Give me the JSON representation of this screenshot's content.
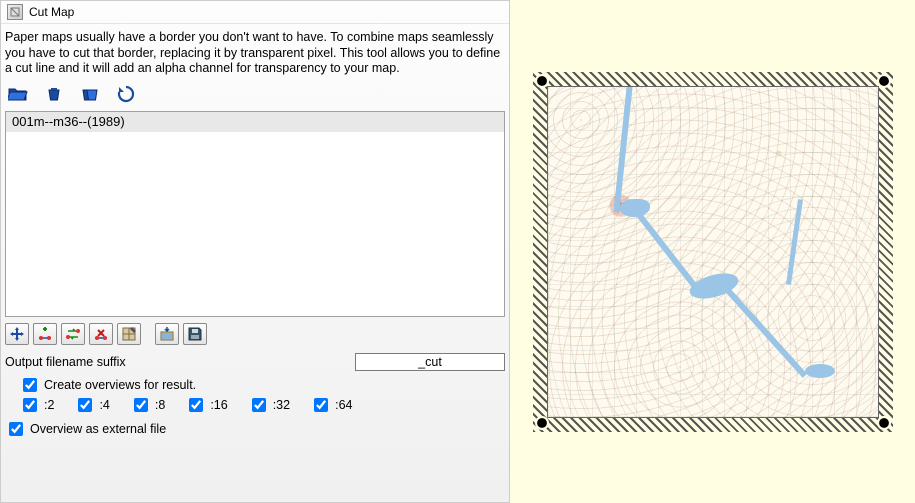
{
  "title": "Cut Map",
  "description": "Paper maps usually have a border you don't want to have. To combine maps seamlessly you have to cut that border, replacing it by transparent pixel. This tool allows you to define a cut line and it will add an alpha channel for transparency to your map.",
  "list": {
    "items": [
      "001m--m36--(1989)"
    ]
  },
  "form": {
    "suffix_label": "Output filename suffix",
    "suffix_value": "_cut",
    "create_overviews_label": "Create overviews for result.",
    "create_overviews_checked": true,
    "levels": [
      {
        "label": ":2",
        "checked": true
      },
      {
        "label": ":4",
        "checked": true
      },
      {
        "label": ":8",
        "checked": true
      },
      {
        "label": ":16",
        "checked": true
      },
      {
        "label": ":32",
        "checked": true
      },
      {
        "label": ":64",
        "checked": true
      }
    ],
    "external_label": "Overview as external file",
    "external_checked": true
  },
  "toolbar1": {
    "open": "Open",
    "delete": "Delete",
    "delete_all": "Delete all",
    "reload": "Reload"
  },
  "toolbar2": {
    "move": "Move",
    "add_point": "Add point",
    "swap": "Swap",
    "remove_point": "Remove point",
    "grid": "Grid",
    "export": "Export",
    "save": "Save"
  }
}
